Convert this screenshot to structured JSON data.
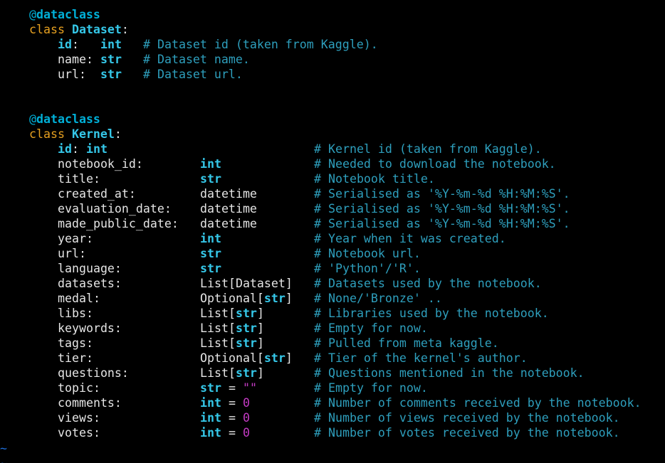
{
  "decorator_at": "@",
  "decorator_name": "dataclass",
  "class_kw": "class",
  "colon": ":",
  "dataset": {
    "name": "Dataset",
    "fields": [
      {
        "name": "id",
        "sep": ":",
        "type": "int",
        "comment": "# Dataset id (taken from Kaggle)."
      },
      {
        "name": "name",
        "sep": ":",
        "type": "str",
        "comment": "# Dataset name."
      },
      {
        "name": "url",
        "sep": ":",
        "type": "str",
        "comment": "# Dataset url."
      }
    ]
  },
  "kernel": {
    "name": "Kernel",
    "id_line": {
      "name": "id",
      "sep": ": ",
      "type": "int",
      "comment": "# Kernel id (taken from Kaggle)."
    },
    "fields": [
      {
        "name": "notebook_id:",
        "type": "int",
        "type_style": "btype",
        "comment": "# Needed to download the notebook."
      },
      {
        "name": "title:",
        "type": "str",
        "type_style": "btype",
        "comment": "# Notebook title."
      },
      {
        "name": "created_at:",
        "type": "datetime",
        "type_style": "plain",
        "comment": "# Serialised as '%Y-%m-%d %H:%M:%S'."
      },
      {
        "name": "evaluation_date:",
        "type": "datetime",
        "type_style": "plain",
        "comment": "# Serialised as '%Y-%m-%d %H:%M:%S'."
      },
      {
        "name": "made_public_date:",
        "type": "datetime",
        "type_style": "plain",
        "comment": "# Serialised as '%Y-%m-%d %H:%M:%S'."
      },
      {
        "name": "year:",
        "type": "int",
        "type_style": "btype",
        "comment": "# Year when it was created."
      },
      {
        "name": "url:",
        "type": "str",
        "type_style": "btype",
        "comment": "# Notebook url."
      },
      {
        "name": "language:",
        "type": "str",
        "type_style": "btype",
        "comment": "# 'Python'/'R'."
      },
      {
        "name": "datasets:",
        "type_pre": "List[",
        "type_inner": "Dataset",
        "type_inner_style": "plain",
        "type_post": "]",
        "comment": "# Datasets used by the notebook."
      },
      {
        "name": "medal:",
        "type_pre": "Optional[",
        "type_inner": "str",
        "type_inner_style": "btype",
        "type_post": "]",
        "comment": "# None/'Bronze' .."
      },
      {
        "name": "libs:",
        "type_pre": "List[",
        "type_inner": "str",
        "type_inner_style": "btype",
        "type_post": "]",
        "comment": "# Libraries used by the notebook."
      },
      {
        "name": "keywords:",
        "type_pre": "List[",
        "type_inner": "str",
        "type_inner_style": "btype",
        "type_post": "]",
        "comment": "# Empty for now."
      },
      {
        "name": "tags:",
        "type_pre": "List[",
        "type_inner": "str",
        "type_inner_style": "btype",
        "type_post": "]",
        "comment": "# Pulled from meta kaggle."
      },
      {
        "name": "tier:",
        "type_pre": "Optional[",
        "type_inner": "str",
        "type_inner_style": "btype",
        "type_post": "]",
        "comment": "# Tier of the kernel's author."
      },
      {
        "name": "questions:",
        "type_pre": "List[",
        "type_inner": "str",
        "type_inner_style": "btype",
        "type_post": "]",
        "comment": "# Questions mentioned in the notebook."
      },
      {
        "name": "topic:",
        "type": "str",
        "type_style": "btype",
        "assign": " = ",
        "default": "\"\"",
        "comment": "# Empty for now."
      },
      {
        "name": "comments:",
        "type": "int",
        "type_style": "btype",
        "assign": " = ",
        "default": "0",
        "comment": "# Number of comments received by the notebook."
      },
      {
        "name": "views:",
        "type": "int",
        "type_style": "btype",
        "assign": " = ",
        "default": "0",
        "comment": "# Number of views received by the notebook."
      },
      {
        "name": "votes:",
        "type": "int",
        "type_style": "btype",
        "assign": " = ",
        "default": "0",
        "comment": "# Number of votes received by the notebook."
      }
    ]
  },
  "empty_line_marker": "~",
  "colors": {
    "background": "#000000",
    "keyword": "#e6a020",
    "class_name": "#35c7e8",
    "builtin_type": "#35c7e8",
    "comment": "#2e9fbd",
    "literal": "#c43bc4",
    "text": "#e5e5e5",
    "tilde": "#1e6fdb"
  }
}
